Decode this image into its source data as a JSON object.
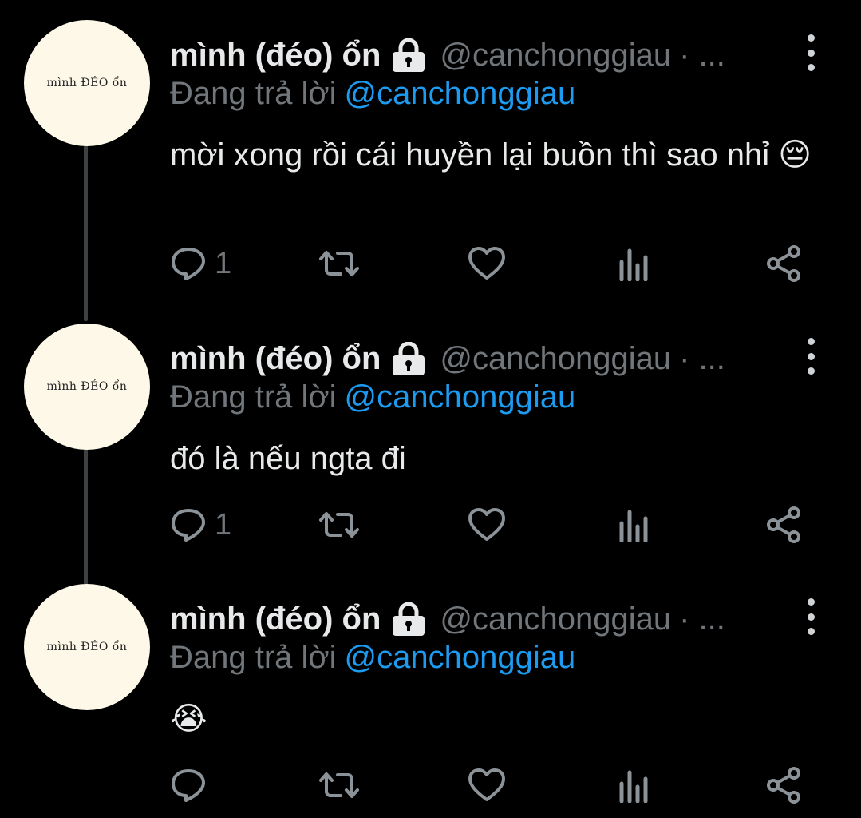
{
  "colors": {
    "background": "#000000",
    "name": "#e7e9ea",
    "muted": "#71767b",
    "mention": "#1d9bf0",
    "avatar_bg": "#fdf8e8"
  },
  "tweets": [
    {
      "avatar_text": "mình ĐÉO ổn",
      "name": "mình (đéo) ổn",
      "handle": "@canchonggiau",
      "handle_suffix": "· ...",
      "reply_prefix": "Đang trả lời",
      "reply_to": "@canchonggiau",
      "text": "mời xong rồi cái huyền lại buồn thì sao nhỉ 😔",
      "reply_count": "1"
    },
    {
      "avatar_text": "mình ĐÉO ổn",
      "name": "mình (đéo) ổn",
      "handle": "@canchonggiau",
      "handle_suffix": "· ...",
      "reply_prefix": "Đang trả lời",
      "reply_to": "@canchonggiau",
      "text": "đó là nếu ngta đi",
      "reply_count": "1"
    },
    {
      "avatar_text": "mình ĐÉO ổn",
      "name": "mình (đéo) ổn",
      "handle": "@canchonggiau",
      "handle_suffix": "· ...",
      "reply_prefix": "Đang trả lời",
      "reply_to": "@canchonggiau",
      "text": "😭",
      "reply_count": ""
    }
  ],
  "icons": {
    "lock": "lock-icon",
    "more": "more-vertical-icon",
    "reply": "reply-icon",
    "retweet": "retweet-icon",
    "like": "heart-icon",
    "views": "analytics-icon",
    "share": "share-icon"
  }
}
